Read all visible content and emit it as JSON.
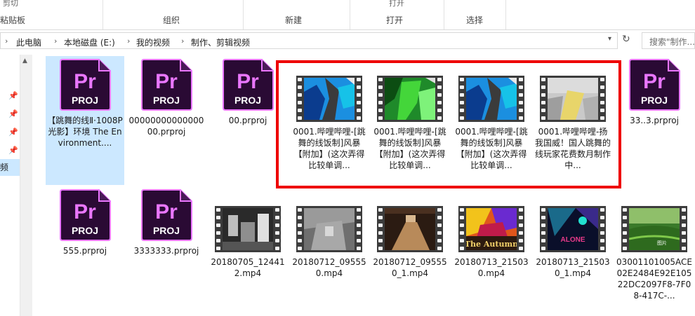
{
  "ribbon": {
    "top_cut": [
      "剪切",
      "",
      "",
      "打开"
    ],
    "groups": [
      "粘贴板",
      "组织",
      "新建",
      "打开",
      "选择"
    ]
  },
  "address": {
    "crumbs": [
      "此电脑",
      "本地磁盘 (E:)",
      "我的视频",
      "制作、剪辑视频"
    ],
    "search_placeholder": "搜索\"制作..."
  },
  "nav": {
    "selected_label": "频"
  },
  "files": [
    {
      "type": "prproj",
      "label": "【跳舞的线Ⅱ·1008P光影】环境 The Environment....",
      "selected": true
    },
    {
      "type": "prproj",
      "label": "0000000000000000.prproj"
    },
    {
      "type": "prproj",
      "label": "00.prproj"
    },
    {
      "type": "mp4",
      "label": "0001.哔哩哔哩-[跳舞的线饭制]风暴【附加】(这次弄得比较单调...",
      "thumb": "blue-storm"
    },
    {
      "type": "mp4",
      "label": "0001.哔哩哔哩-[跳舞的线饭制]风暴【附加】(这次弄得比较单调...",
      "thumb": "green-storm"
    },
    {
      "type": "mp4",
      "label": "0001.哔哩哔哩-[跳舞的线饭制]风暴【附加】(这次弄得比较单调...",
      "thumb": "blue-storm"
    },
    {
      "type": "mp4",
      "label": "0001.哔哩哔哩-扬我国威！国人跳舞的线玩家花费数月制作中...",
      "thumb": "grey-stairs"
    },
    {
      "type": "prproj",
      "label": "33..3.prproj"
    },
    {
      "type": "prproj",
      "label": "555.prproj"
    },
    {
      "type": "prproj",
      "label": "3333333.prproj"
    },
    {
      "type": "mp4",
      "label": "20180705_124412.mp4",
      "thumb": "dark-city"
    },
    {
      "type": "mp4",
      "label": "20180712_095550.mp4",
      "thumb": "grey-room"
    },
    {
      "type": "mp4",
      "label": "20180712_095550_1.mp4",
      "thumb": "brown-path"
    },
    {
      "type": "mp4",
      "label": "20180713_215030.mp4",
      "thumb": "the-autumn"
    },
    {
      "type": "mp4",
      "label": "20180713_215030_1.mp4",
      "thumb": "alone"
    },
    {
      "type": "mp4",
      "label": "03001101005ACE02E2484E92E10522DC2097F8-7F08-417C-...",
      "thumb": "green-field"
    }
  ],
  "icons": {
    "pr_top": "Pr",
    "pr_bottom": "PROJ",
    "thumb_text": {
      "the-autumn": "The Autumn",
      "alone": "ALONE",
      "green-field": "图片"
    }
  },
  "colors": {
    "accent": "#ee0000",
    "selection": "#cce8ff",
    "pr_bg": "#2a0a34",
    "pr_text": "#ea77ff"
  }
}
